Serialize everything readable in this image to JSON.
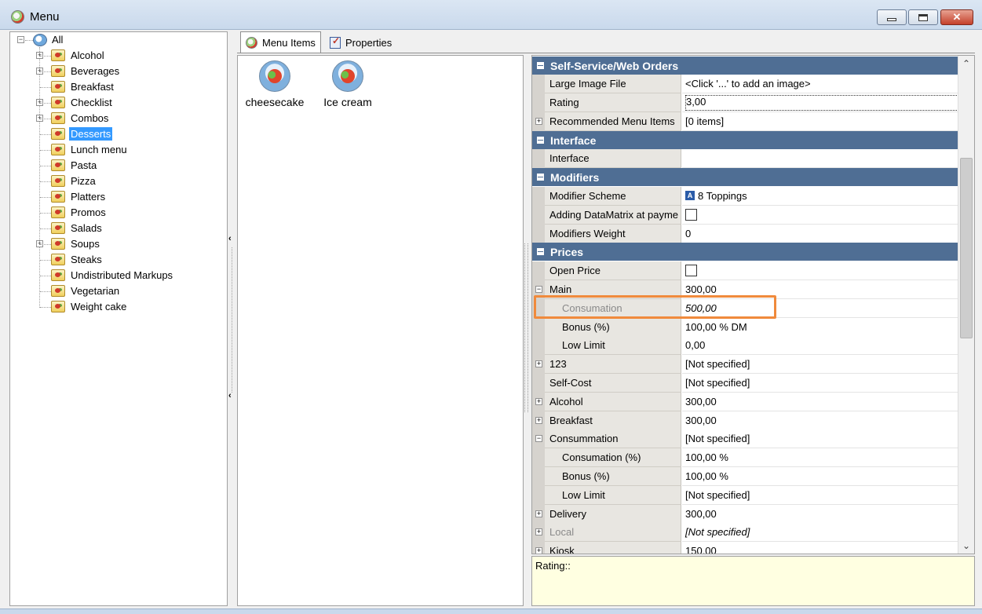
{
  "window": {
    "title": "Menu",
    "minimize": "–",
    "maximize": "□",
    "close": "✕"
  },
  "tree": {
    "root": "All",
    "items": [
      {
        "label": "Alcohol",
        "expandable": true
      },
      {
        "label": "Beverages",
        "expandable": true
      },
      {
        "label": "Breakfast",
        "expandable": false
      },
      {
        "label": "Checklist",
        "expandable": true
      },
      {
        "label": "Combos",
        "expandable": true
      },
      {
        "label": "Desserts",
        "expandable": false,
        "selected": true
      },
      {
        "label": "Lunch menu",
        "expandable": false
      },
      {
        "label": "Pasta",
        "expandable": false
      },
      {
        "label": "Pizza",
        "expandable": false
      },
      {
        "label": "Platters",
        "expandable": false
      },
      {
        "label": "Promos",
        "expandable": false
      },
      {
        "label": "Salads",
        "expandable": false
      },
      {
        "label": "Soups",
        "expandable": true
      },
      {
        "label": "Steaks",
        "expandable": false
      },
      {
        "label": "Undistributed Markups",
        "expandable": false
      },
      {
        "label": "Vegetarian",
        "expandable": false
      },
      {
        "label": "Weight cake",
        "expandable": false
      }
    ]
  },
  "tabs": {
    "menu_items": "Menu Items",
    "properties": "Properties"
  },
  "menu_items": [
    {
      "label": "cheesecake"
    },
    {
      "label": "Ice cream"
    }
  ],
  "properties": {
    "cat_self_service": "Self-Service/Web Orders",
    "large_image_file": {
      "name": "Large Image File",
      "value": "<Click '...' to add an image>"
    },
    "rating": {
      "name": "Rating",
      "value": "3,00"
    },
    "recommended": {
      "name": "Recommended Menu Items",
      "value": "[0 items]"
    },
    "cat_interface": "Interface",
    "interface": {
      "name": "Interface",
      "value": ""
    },
    "cat_modifiers": "Modifiers",
    "modifier_scheme": {
      "name": "Modifier Scheme",
      "value": "8 Toppings",
      "icon_letter": "A"
    },
    "adding_datamatrix": {
      "name": "Adding DataMatrix at payme",
      "checked": false
    },
    "modifiers_weight": {
      "name": "Modifiers Weight",
      "value": "0"
    },
    "cat_prices": "Prices",
    "open_price": {
      "name": "Open Price",
      "checked": false
    },
    "main": {
      "name": "Main",
      "value": "300,00"
    },
    "consumation": {
      "name": "Consumation",
      "value": "500,00"
    },
    "bonus_main": {
      "name": "Bonus (%)",
      "value": "100,00 % DM"
    },
    "low_limit_main": {
      "name": "Low Limit",
      "value": "0,00"
    },
    "p123": {
      "name": "123",
      "value": "[Not specified]"
    },
    "self_cost": {
      "name": "Self-Cost",
      "value": "[Not specified]"
    },
    "alcohol": {
      "name": "Alcohol",
      "value": "300,00"
    },
    "breakfast": {
      "name": "Breakfast",
      "value": "300,00"
    },
    "consummation": {
      "name": "Consummation",
      "value": "[Not specified]"
    },
    "consumation_pct": {
      "name": "Consumation (%)",
      "value": "100,00 %"
    },
    "bonus_cons": {
      "name": "Bonus (%)",
      "value": "100,00 %"
    },
    "low_limit_cons": {
      "name": "Low Limit",
      "value": "[Not specified]"
    },
    "delivery": {
      "name": "Delivery",
      "value": "300,00"
    },
    "local": {
      "name": "Local",
      "value": "[Not specified]"
    },
    "kiosk": {
      "name": "Kiosk",
      "value": "150,00"
    }
  },
  "description": {
    "text": "Rating::"
  },
  "colors": {
    "category_bg": "#4f6e94",
    "selection": "#3399ff",
    "highlight_border": "#f08a3c",
    "desc_bg": "#ffffe1"
  }
}
